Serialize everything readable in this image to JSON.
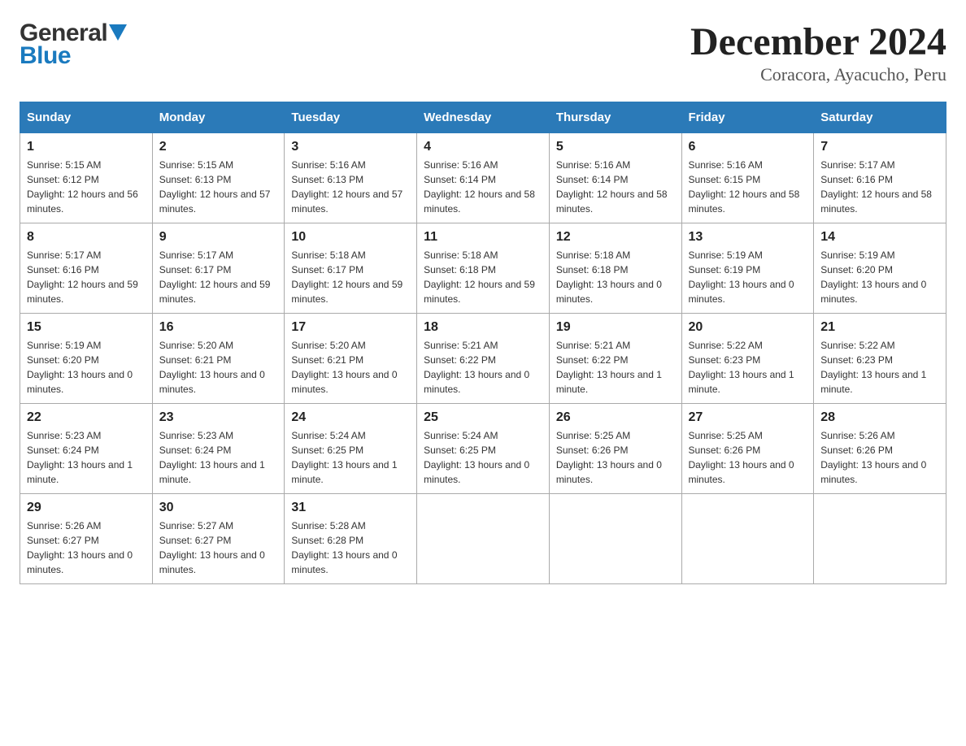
{
  "header": {
    "logo_general": "General",
    "logo_blue": "Blue",
    "month_title": "December 2024",
    "location": "Coracora, Ayacucho, Peru"
  },
  "days_of_week": [
    "Sunday",
    "Monday",
    "Tuesday",
    "Wednesday",
    "Thursday",
    "Friday",
    "Saturday"
  ],
  "weeks": [
    [
      {
        "day": "1",
        "sunrise": "5:15 AM",
        "sunset": "6:12 PM",
        "daylight": "12 hours and 56 minutes."
      },
      {
        "day": "2",
        "sunrise": "5:15 AM",
        "sunset": "6:13 PM",
        "daylight": "12 hours and 57 minutes."
      },
      {
        "day": "3",
        "sunrise": "5:16 AM",
        "sunset": "6:13 PM",
        "daylight": "12 hours and 57 minutes."
      },
      {
        "day": "4",
        "sunrise": "5:16 AM",
        "sunset": "6:14 PM",
        "daylight": "12 hours and 58 minutes."
      },
      {
        "day": "5",
        "sunrise": "5:16 AM",
        "sunset": "6:14 PM",
        "daylight": "12 hours and 58 minutes."
      },
      {
        "day": "6",
        "sunrise": "5:16 AM",
        "sunset": "6:15 PM",
        "daylight": "12 hours and 58 minutes."
      },
      {
        "day": "7",
        "sunrise": "5:17 AM",
        "sunset": "6:16 PM",
        "daylight": "12 hours and 58 minutes."
      }
    ],
    [
      {
        "day": "8",
        "sunrise": "5:17 AM",
        "sunset": "6:16 PM",
        "daylight": "12 hours and 59 minutes."
      },
      {
        "day": "9",
        "sunrise": "5:17 AM",
        "sunset": "6:17 PM",
        "daylight": "12 hours and 59 minutes."
      },
      {
        "day": "10",
        "sunrise": "5:18 AM",
        "sunset": "6:17 PM",
        "daylight": "12 hours and 59 minutes."
      },
      {
        "day": "11",
        "sunrise": "5:18 AM",
        "sunset": "6:18 PM",
        "daylight": "12 hours and 59 minutes."
      },
      {
        "day": "12",
        "sunrise": "5:18 AM",
        "sunset": "6:18 PM",
        "daylight": "13 hours and 0 minutes."
      },
      {
        "day": "13",
        "sunrise": "5:19 AM",
        "sunset": "6:19 PM",
        "daylight": "13 hours and 0 minutes."
      },
      {
        "day": "14",
        "sunrise": "5:19 AM",
        "sunset": "6:20 PM",
        "daylight": "13 hours and 0 minutes."
      }
    ],
    [
      {
        "day": "15",
        "sunrise": "5:19 AM",
        "sunset": "6:20 PM",
        "daylight": "13 hours and 0 minutes."
      },
      {
        "day": "16",
        "sunrise": "5:20 AM",
        "sunset": "6:21 PM",
        "daylight": "13 hours and 0 minutes."
      },
      {
        "day": "17",
        "sunrise": "5:20 AM",
        "sunset": "6:21 PM",
        "daylight": "13 hours and 0 minutes."
      },
      {
        "day": "18",
        "sunrise": "5:21 AM",
        "sunset": "6:22 PM",
        "daylight": "13 hours and 0 minutes."
      },
      {
        "day": "19",
        "sunrise": "5:21 AM",
        "sunset": "6:22 PM",
        "daylight": "13 hours and 1 minute."
      },
      {
        "day": "20",
        "sunrise": "5:22 AM",
        "sunset": "6:23 PM",
        "daylight": "13 hours and 1 minute."
      },
      {
        "day": "21",
        "sunrise": "5:22 AM",
        "sunset": "6:23 PM",
        "daylight": "13 hours and 1 minute."
      }
    ],
    [
      {
        "day": "22",
        "sunrise": "5:23 AM",
        "sunset": "6:24 PM",
        "daylight": "13 hours and 1 minute."
      },
      {
        "day": "23",
        "sunrise": "5:23 AM",
        "sunset": "6:24 PM",
        "daylight": "13 hours and 1 minute."
      },
      {
        "day": "24",
        "sunrise": "5:24 AM",
        "sunset": "6:25 PM",
        "daylight": "13 hours and 1 minute."
      },
      {
        "day": "25",
        "sunrise": "5:24 AM",
        "sunset": "6:25 PM",
        "daylight": "13 hours and 0 minutes."
      },
      {
        "day": "26",
        "sunrise": "5:25 AM",
        "sunset": "6:26 PM",
        "daylight": "13 hours and 0 minutes."
      },
      {
        "day": "27",
        "sunrise": "5:25 AM",
        "sunset": "6:26 PM",
        "daylight": "13 hours and 0 minutes."
      },
      {
        "day": "28",
        "sunrise": "5:26 AM",
        "sunset": "6:26 PM",
        "daylight": "13 hours and 0 minutes."
      }
    ],
    [
      {
        "day": "29",
        "sunrise": "5:26 AM",
        "sunset": "6:27 PM",
        "daylight": "13 hours and 0 minutes."
      },
      {
        "day": "30",
        "sunrise": "5:27 AM",
        "sunset": "6:27 PM",
        "daylight": "13 hours and 0 minutes."
      },
      {
        "day": "31",
        "sunrise": "5:28 AM",
        "sunset": "6:28 PM",
        "daylight": "13 hours and 0 minutes."
      },
      null,
      null,
      null,
      null
    ]
  ],
  "labels": {
    "sunrise": "Sunrise:",
    "sunset": "Sunset:",
    "daylight": "Daylight:"
  }
}
